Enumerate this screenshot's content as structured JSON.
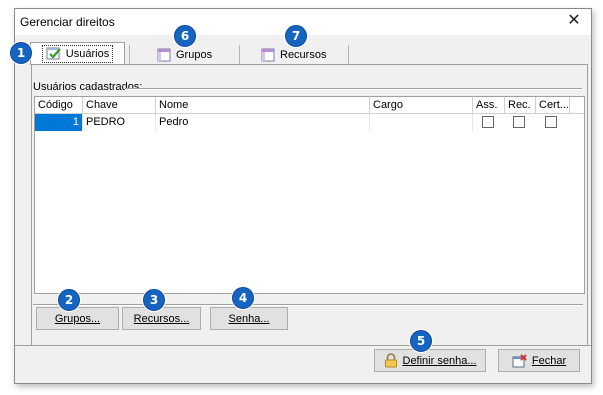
{
  "window": {
    "title": "Gerenciar direitos",
    "close_glyph": "✕"
  },
  "tabs": [
    {
      "label": "Usuários",
      "icon": "user-check-icon",
      "active": true
    },
    {
      "label": "Grupos",
      "icon": "window-icon",
      "active": false
    },
    {
      "label": "Recursos",
      "icon": "window-icon",
      "active": false
    }
  ],
  "group": {
    "label": "Usuários cadastrados:"
  },
  "grid": {
    "columns": [
      "Código",
      "Chave",
      "Nome",
      "Cargo",
      "Ass.",
      "Rec.",
      "Cert..."
    ],
    "rows": [
      {
        "codigo": "1",
        "chave": "PEDRO",
        "nome": "Pedro",
        "cargo": "",
        "ass": false,
        "rec": false,
        "cert": false
      }
    ]
  },
  "buttons": {
    "grupos": "Grupos...",
    "recursos": "Recursos...",
    "senha": "Senha...",
    "definir_senha": "Definir senha...",
    "fechar": "Fechar"
  },
  "badges": [
    "1",
    "2",
    "3",
    "4",
    "5",
    "6",
    "7"
  ],
  "colors": {
    "badge": "#1565c0",
    "selection": "#0078d7"
  }
}
